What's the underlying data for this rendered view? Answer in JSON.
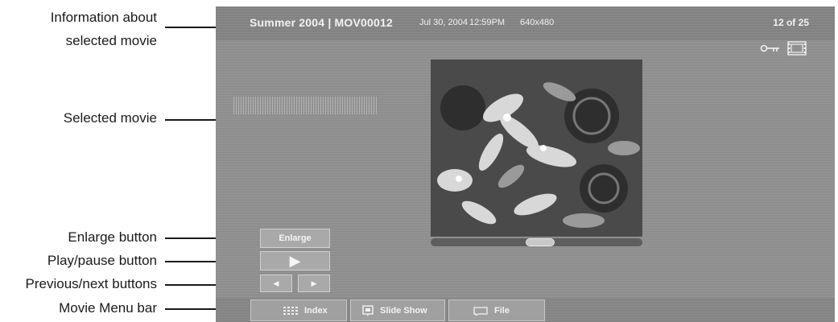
{
  "callouts": {
    "info_line1": "Information about",
    "info_line2": "selected movie",
    "selected_movie": "Selected movie",
    "enlarge": "Enlarge button",
    "play_pause": "Play/pause button",
    "prev_next": "Previous/next buttons",
    "menu_bar": "Movie Menu bar"
  },
  "info_bar": {
    "title": "Summer 2004  |  MOV00012",
    "date": "Jul 30, 2004",
    "time": "12:59PM",
    "resolution": "640x480",
    "count": "12 of 25"
  },
  "icons": {
    "protect": "key-icon",
    "type": "film-icon"
  },
  "movie": {
    "progress": 0.52
  },
  "controls": {
    "enlarge_label": "Enlarge",
    "play_glyph": "▶",
    "prev_glyph": "◀",
    "next_glyph": "▶"
  },
  "menu": {
    "index_label": "Index",
    "slideshow_label": "Slide Show",
    "file_label": "File"
  }
}
